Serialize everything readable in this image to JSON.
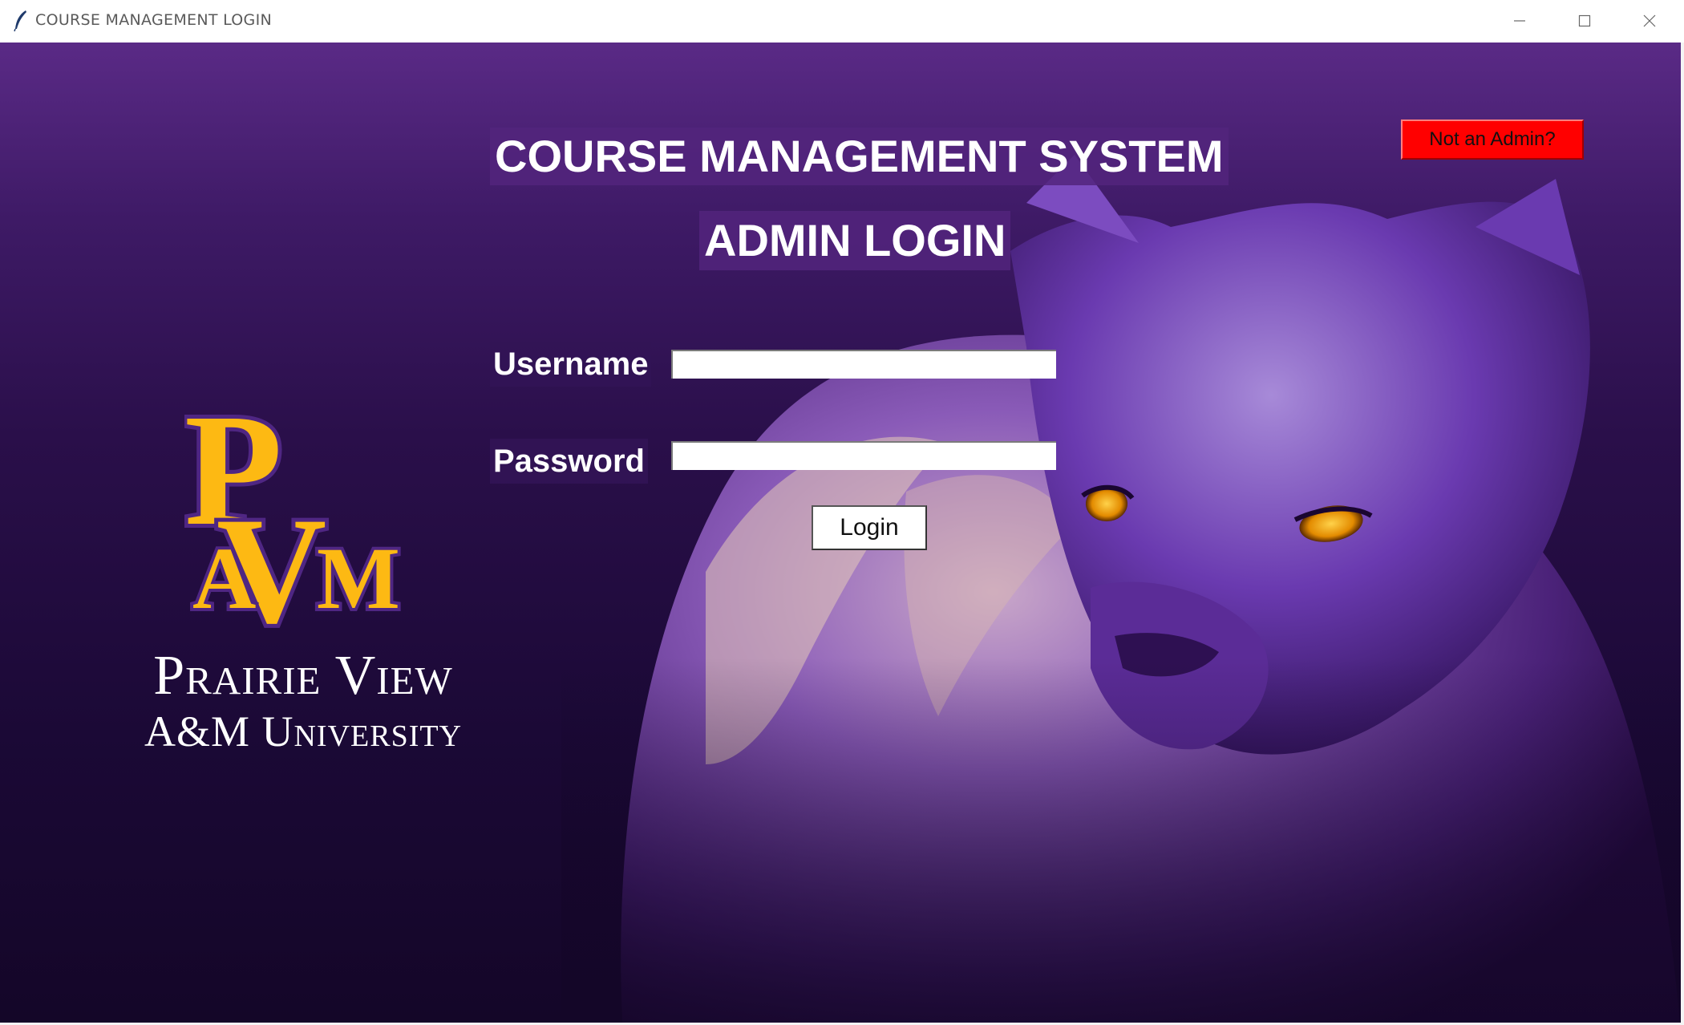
{
  "window": {
    "title": "COURSE MANAGEMENT LOGIN",
    "app_icon": "feather-icon",
    "controls": {
      "minimize_icon": "minimize-icon",
      "maximize_icon": "maximize-icon",
      "close_icon": "close-icon"
    }
  },
  "header": {
    "title": "COURSE MANAGEMENT SYSTEM",
    "subtitle": "ADMIN LOGIN"
  },
  "form": {
    "username_label": "Username",
    "username_value": "",
    "password_label": "Password",
    "password_value": "",
    "login_label": "Login"
  },
  "switch_role_button": "Not an Admin?",
  "branding": {
    "logo_letters": "PVAM",
    "university_line1": "Prairie View",
    "university_line2": "A&M University"
  },
  "colors": {
    "background_top": "#5a2a86",
    "background_bottom": "#140628",
    "heading_box": "#52247c",
    "not_admin_button": "#ff0000",
    "logo_gold": "#fdb913",
    "logo_purple": "#4f2683"
  }
}
